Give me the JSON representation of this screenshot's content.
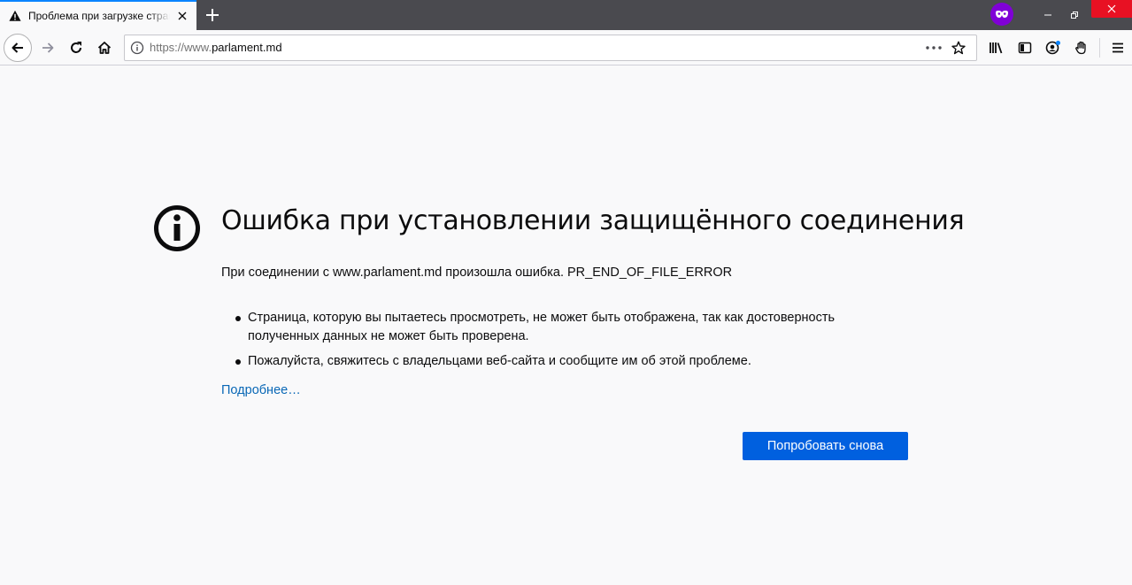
{
  "tab": {
    "title": "Проблема при загрузке страницы",
    "status_icon": "warning-icon"
  },
  "navbar": {
    "url_scheme": "https://www.",
    "url_host": "parlament.md"
  },
  "error": {
    "title": "Ошибка при установлении защищённого соединения",
    "description": "При соединении с www.parlament.md произошла ошибка. PR_END_OF_FILE_ERROR",
    "bullets": [
      "Страница, которую вы пытаетесь просмотреть, не может быть отображена, так как достоверность полученных данных не может быть проверена.",
      "Пожалуйста, свяжитесь с владельцами веб-сайта и сообщите им об этой проблеме."
    ],
    "learn_more": "Подробнее…",
    "retry_label": "Попробовать снова"
  },
  "colors": {
    "accent": "#0060df",
    "link": "#0a68b6",
    "private_browsing": "#8000d7",
    "close_button": "#e81123"
  }
}
